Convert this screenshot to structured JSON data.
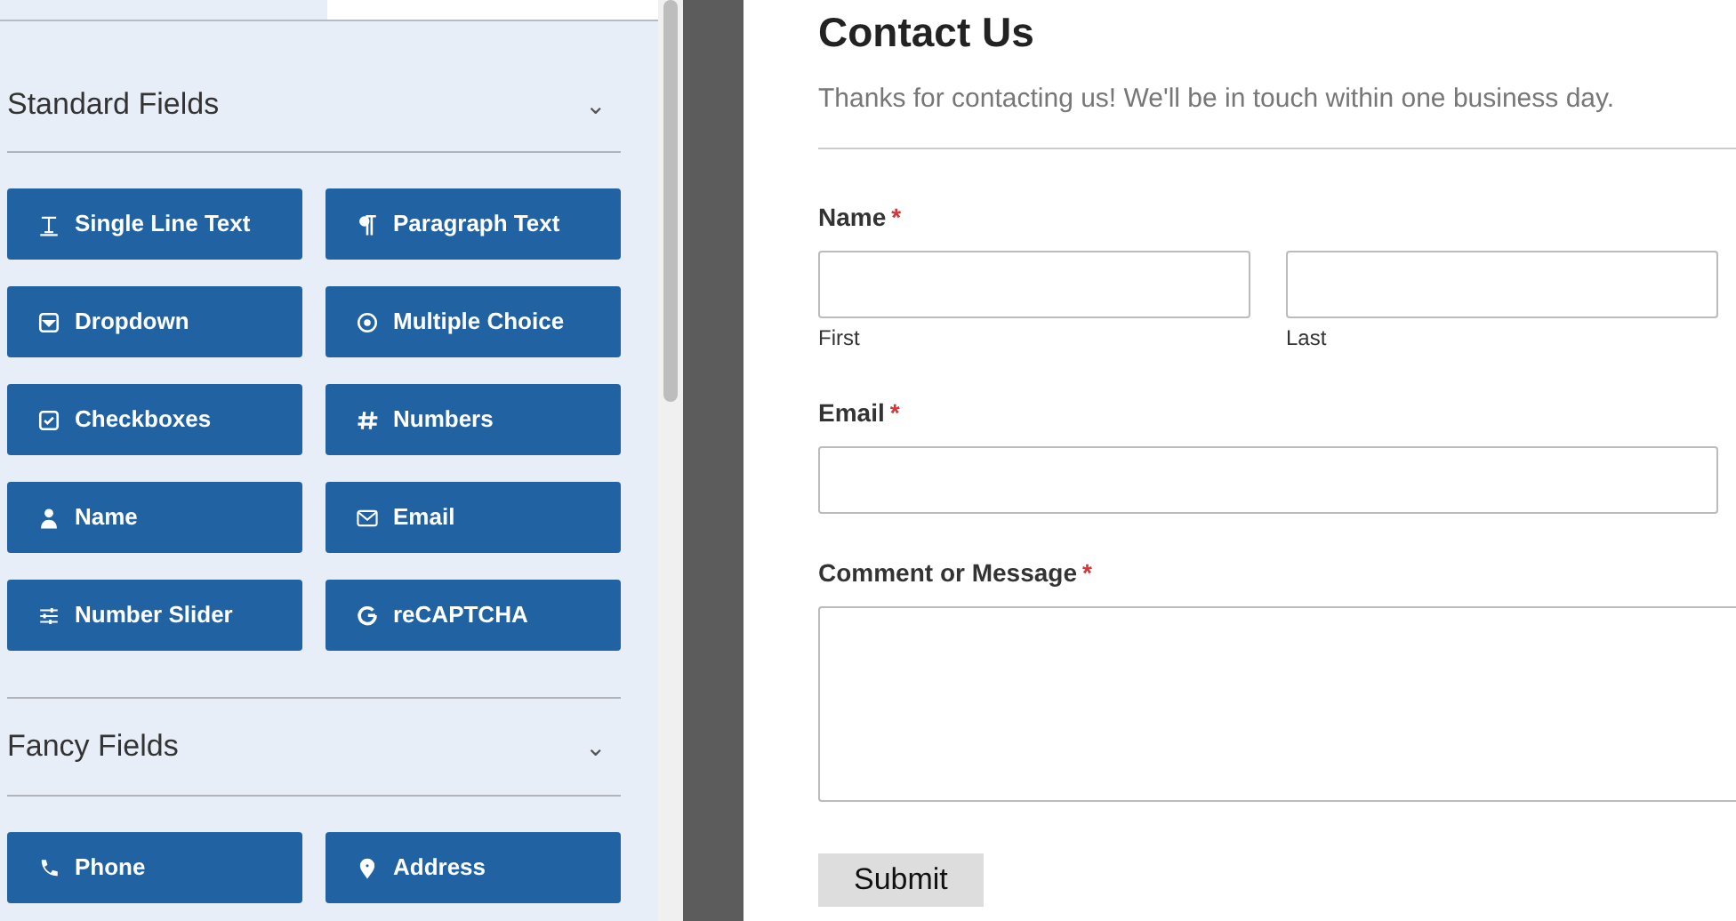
{
  "sidebar": {
    "sections": [
      {
        "title": "Standard Fields",
        "chevron": "⌄",
        "fields": [
          {
            "label": "Single Line Text"
          },
          {
            "label": "Paragraph Text"
          },
          {
            "label": "Dropdown"
          },
          {
            "label": "Multiple Choice"
          },
          {
            "label": "Checkboxes"
          },
          {
            "label": "Numbers"
          },
          {
            "label": "Name"
          },
          {
            "label": "Email"
          },
          {
            "label": "Number Slider"
          },
          {
            "label": "reCAPTCHA"
          }
        ]
      },
      {
        "title": "Fancy Fields",
        "chevron": "⌄",
        "fields": [
          {
            "label": "Phone"
          },
          {
            "label": "Address"
          }
        ]
      }
    ]
  },
  "form": {
    "title": "Contact Us",
    "description": "Thanks for contacting us! We'll be in touch within one business day.",
    "fields": [
      {
        "kind": "name",
        "label": "Name",
        "required_mark": "*",
        "sublabels": [
          "First",
          "Last"
        ]
      },
      {
        "kind": "email",
        "label": "Email",
        "required_mark": "*"
      },
      {
        "kind": "textarea",
        "label": "Comment or Message",
        "required_mark": "*"
      }
    ],
    "submit": "Submit"
  }
}
